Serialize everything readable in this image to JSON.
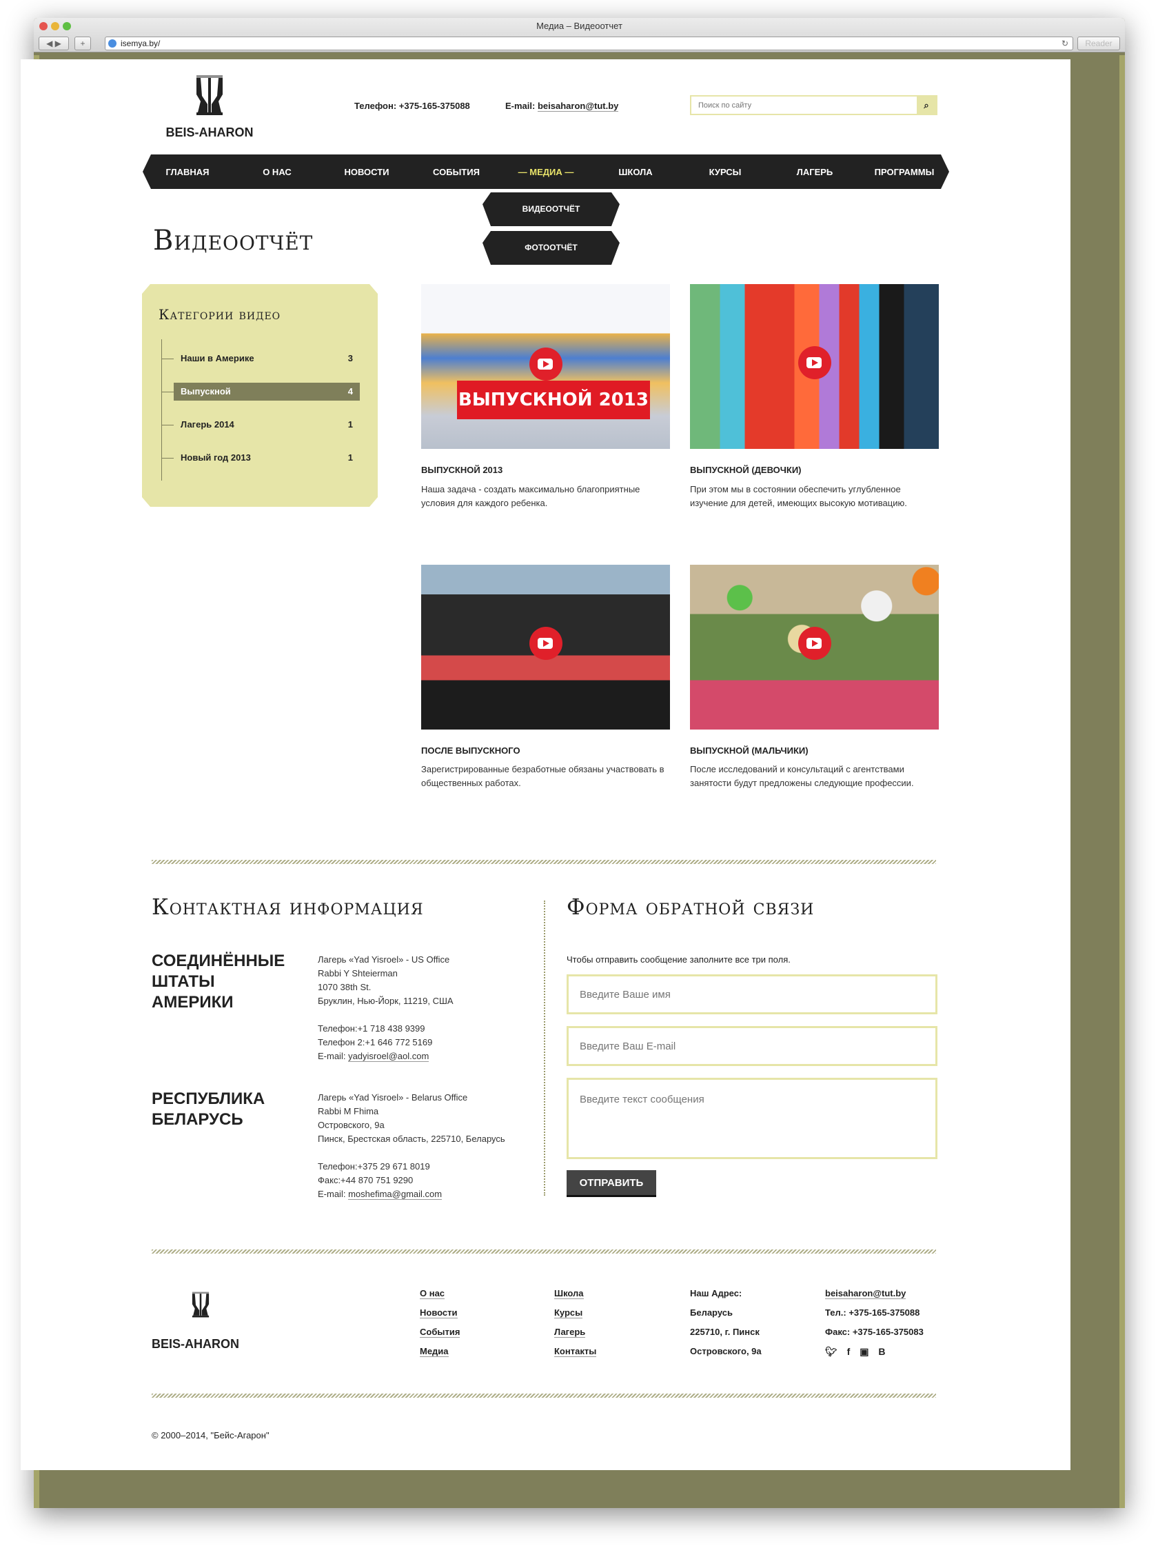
{
  "browser": {
    "title": "Медиа – Видеоотчет",
    "url": "isemya.by/",
    "reader": "Reader"
  },
  "header": {
    "logo_text": "BEIS-AHARON",
    "phone": "Телефон: +375-165-375088",
    "email_label": "E-mail:",
    "email": "beisaharon@tut.by",
    "search_placeholder": "Поиск по сайту"
  },
  "nav": [
    "ГЛАВНАЯ",
    "О НАС",
    "НОВОСТИ",
    "СОБЫТИЯ",
    "МЕДИА",
    "ШКОЛА",
    "КУРСЫ",
    "ЛАГЕРЬ",
    "ПРОГРАММЫ"
  ],
  "dropdown": [
    "ВИДЕООТЧЁТ",
    "ФОТООТЧЁТ"
  ],
  "page_title": "Видеоотчёт",
  "sidebar": {
    "title": "Категории видео",
    "items": [
      {
        "label": "Наши в Америке",
        "count": "3"
      },
      {
        "label": "Выпускной",
        "count": "4"
      },
      {
        "label": "Лагерь 2014",
        "count": "1"
      },
      {
        "label": "Новый год 2013",
        "count": "1"
      }
    ]
  },
  "videos": [
    {
      "title": "ВЫПУСКНОЙ 2013",
      "banner": "ВЫПУСКНОЙ 2013",
      "desc": "Наша задача - создать максимально благоприятные условия для каждого ребенка."
    },
    {
      "title": "ВЫПУСКНОЙ (ДЕВОЧКИ)",
      "desc": "При этом мы в состоянии обеспечить углубленное изучение для детей, имеющих высокую мотивацию."
    },
    {
      "title": "ПОСЛЕ ВЫПУСКНОГО",
      "desc": "Зарегистрированные безработные обязаны участвовать в общественных работах."
    },
    {
      "title": "ВЫПУСКНОЙ (МАЛЬЧИКИ)",
      "desc": "После исследований и консультаций с агентствами занятости будут предложены следующие профессии."
    }
  ],
  "contacts": {
    "title": "Контактная информация",
    "regions": [
      {
        "name": "СОЕДИНЁННЫЕ ШТАТЫ АМЕРИКИ",
        "lines": [
          "Лагерь «Yad Yisroel» - US Office",
          "Rabbi Y Shteierman",
          "1070 38th St.",
          "Бруклин, Нью-Йорк, 11219, США"
        ],
        "phones": [
          "Телефон:+1 718 438 9399",
          "Телефон 2:+1 646 772 5169"
        ],
        "email_label": "E-mail:",
        "email": "yadyisroel@aol.com"
      },
      {
        "name": "РЕСПУБЛИКА БЕЛАРУСЬ",
        "lines": [
          "Лагерь «Yad Yisroel» - Belarus Office",
          "Rabbi M Fhima",
          "Островского, 9а",
          "Пинск, Брестская область, 225710, Беларусь"
        ],
        "phones": [
          "Телефон:+375 29 671 8019",
          "Факс:+44 870 751 9290"
        ],
        "email_label": "E-mail:",
        "email": "moshefima@gmail.com"
      }
    ]
  },
  "form": {
    "title": "Форма обратной связи",
    "hint": "Чтобы отправить сообщение заполните все три поля.",
    "name_placeholder": "Введите Ваше имя",
    "email_placeholder": "Введите Ваш E-mail",
    "message_placeholder": "Введите текст сообщения",
    "submit": "ОТПРАВИТЬ"
  },
  "footer": {
    "logo_text": "BEIS-AHARON",
    "col1": [
      "О нас",
      "Новости",
      "События",
      "Медиа"
    ],
    "col2": [
      "Школа",
      "Курсы",
      "Лагерь",
      "Контакты"
    ],
    "address": [
      "Наш Адрес:",
      "Беларусь",
      "225710, г. Пинск",
      "Островского, 9а"
    ],
    "email": "beisaharon@tut.by",
    "tel": "Тел.: +375-165-375088",
    "fax": "Факс: +375-165-375083",
    "vk": "B",
    "copyright": "© 2000–2014, \"Бейс-Агарон\""
  },
  "colors": {
    "olive": "#7f7f5a",
    "cream": "#e6e5a8",
    "accent": "#e8e36a",
    "nav": "#222222"
  }
}
